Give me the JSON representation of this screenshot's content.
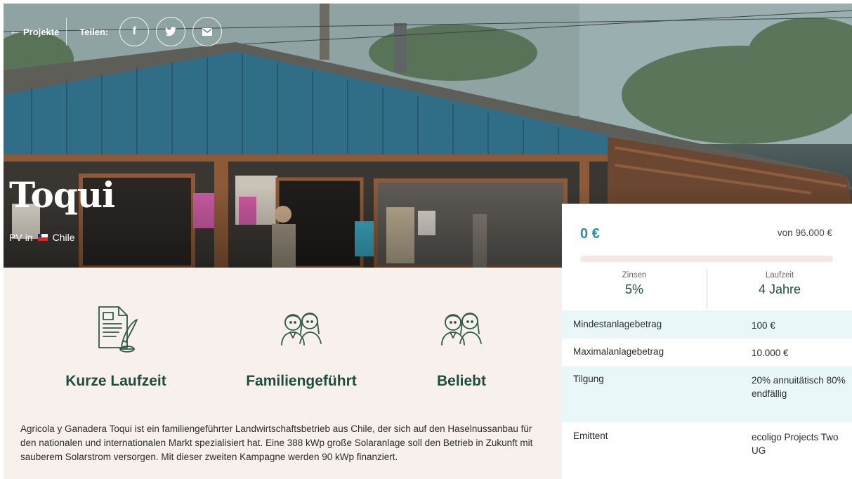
{
  "nav": {
    "back_label": "Projekte",
    "share_label": "Teilen:",
    "share_buttons": [
      {
        "icon": "facebook-icon",
        "glyph": "f"
      },
      {
        "icon": "twitter-icon",
        "glyph": "🐦"
      },
      {
        "icon": "email-icon",
        "glyph": "✉"
      }
    ]
  },
  "project": {
    "title": "Toqui",
    "type": "PV",
    "in_word": "in",
    "country": "Chile"
  },
  "features": [
    {
      "icon": "document-quill-icon",
      "label": "Kurze Laufzeit"
    },
    {
      "icon": "family-icon",
      "label": "Familiengeführt"
    },
    {
      "icon": "people-icon",
      "label": "Beliebt"
    }
  ],
  "description": "Agricola y Ganadera Toqui ist ein familiengeführter Landwirtschaftsbetrieb aus Chile, der sich auf den Haselnussanbau für den nationalen und internationalen Markt spezialisiert hat. Eine 388 kWp große Solaranlage soll den Betrieb in Zukunft mit sauberem Solarstrom versorgen. Mit dieser zweiten Kampagne werden 90 kWp finanziert.",
  "funding": {
    "raised": "0 €",
    "target": "von 96.000 €",
    "progress_fraction": 0,
    "interest_label": "Zinsen",
    "interest_value": "5%",
    "term_label": "Laufzeit",
    "term_value": "4 Jahre"
  },
  "details": [
    {
      "key": "Mindestanlagebetrag",
      "value": "100 €"
    },
    {
      "key": "Maximalanlagebetrag",
      "value": "10.000 €"
    },
    {
      "key": "Tilgung",
      "value": "20% annuitätisch 80% endfällig"
    },
    {
      "key": "Emittent",
      "value": "ecoligo Projects Two UG"
    }
  ],
  "colors": {
    "accent": "#2a8fa0",
    "heading_green": "#1f4d3d",
    "content_bg": "#f7f0ed",
    "row_shade": "#e9f7f8"
  }
}
